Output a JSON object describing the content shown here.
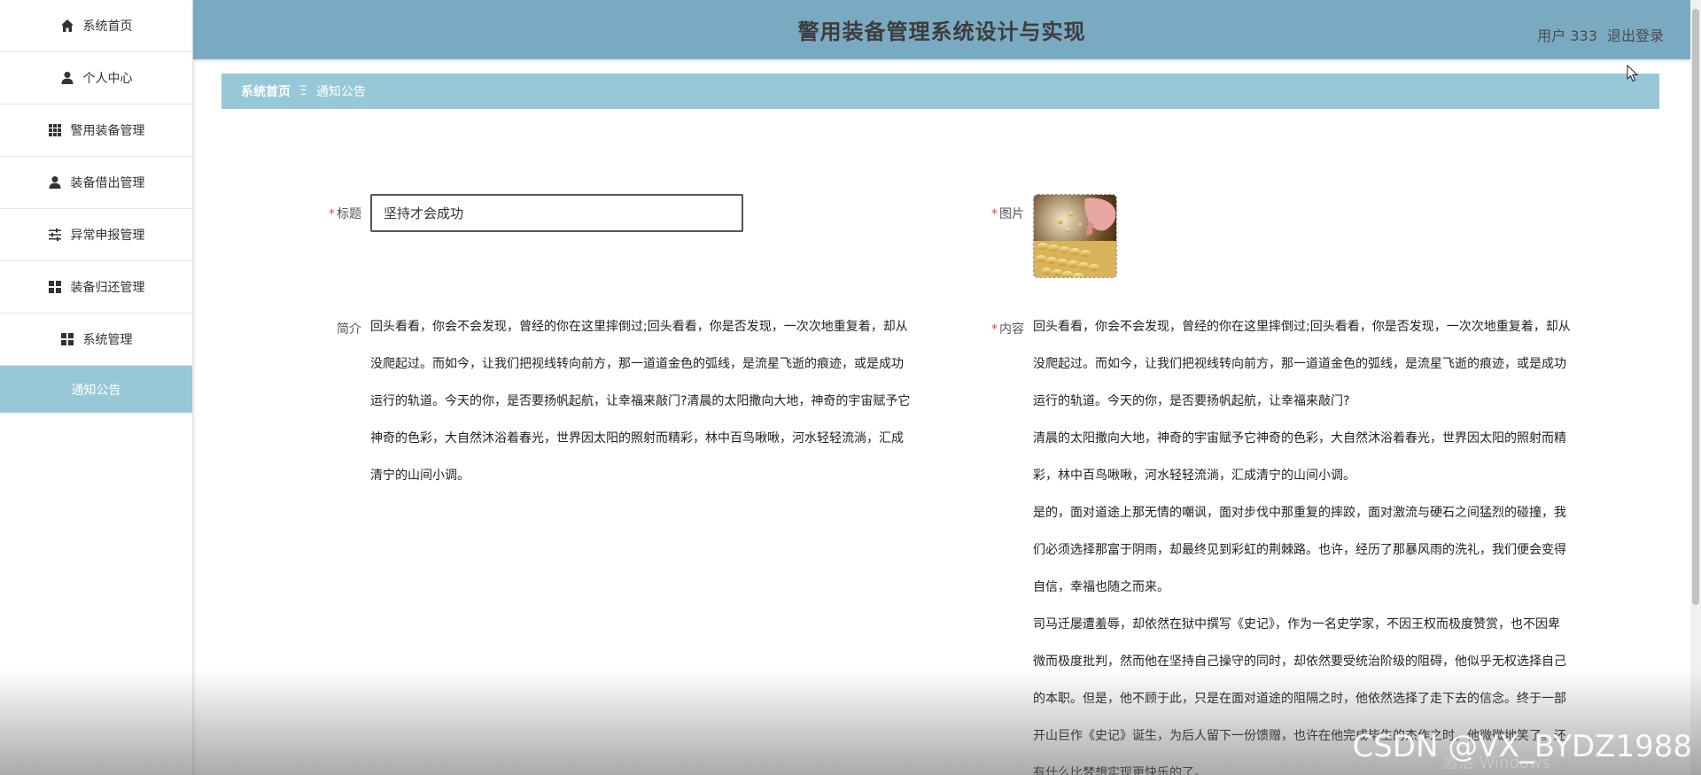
{
  "header": {
    "title": "警用装备管理系统设计与实现",
    "user_label": "用户 333",
    "logout_label": "退出登录"
  },
  "sidebar": {
    "items": [
      {
        "label": "系统首页",
        "icon": "home-icon"
      },
      {
        "label": "个人中心",
        "icon": "user-icon"
      },
      {
        "label": "警用装备管理",
        "icon": "grid-icon"
      },
      {
        "label": "装备借出管理",
        "icon": "user-icon"
      },
      {
        "label": "异常申报管理",
        "icon": "sliders-icon"
      },
      {
        "label": "装备归还管理",
        "icon": "apps-icon"
      },
      {
        "label": "系统管理",
        "icon": "apps-icon"
      }
    ],
    "sub_active": "通知公告"
  },
  "breadcrumb": {
    "home": "系统首页",
    "separator": "Ξ",
    "current": "通知公告"
  },
  "form": {
    "title_label": "标题",
    "title_value": "坚持才会成功",
    "image_label": "图片",
    "summary_label": "简介",
    "summary_lines": [
      "回头看看，你会不会发现，曾经的你在这里摔倒过;回头看看，你是否发现，一次次地重复着，却从",
      "没爬起过。而如今，让我们把视线转向前方，那一道道金色的弧线，是流星飞逝的痕迹，或是成功",
      "运行的轨道。今天的你，是否要扬帆起航，让幸福来敲门?清晨的太阳撒向大地，神奇的宇宙赋予它",
      "神奇的色彩，大自然沐浴着春光，世界因太阳的照射而精彩，林中百鸟啾啾，河水轻轻流淌，汇成",
      "清宁的山间小调。"
    ],
    "content_label": "内容",
    "content_lines": [
      "回头看看，你会不会发现，曾经的你在这里摔倒过;回头看看，你是否发现，一次次地重复着，却从",
      "没爬起过。而如今，让我们把视线转向前方，那一道道金色的弧线，是流星飞逝的痕迹，或是成功",
      "运行的轨道。今天的你，是否要扬帆起航，让幸福来敲门?",
      "清晨的太阳撒向大地，神奇的宇宙赋予它神奇的色彩，大自然沐浴着春光，世界因太阳的照射而精",
      "彩，林中百鸟啾啾，河水轻轻流淌，汇成清宁的山间小调。",
      "是的，面对道途上那无情的嘲讽，面对步伐中那重复的摔跤，面对激流与硬石之间猛烈的碰撞，我",
      "们必须选择那富于阴雨，却最终见到彩虹的荆棘路。也许，经历了那暴风雨的洗礼，我们便会变得",
      "自信，幸福也随之而来。",
      "司马迁屡遭羞辱，却依然在狱中撰写《史记》，作为一名史学家，不因王权而极度赞赏，也不因卑",
      "微而极度批判，然而他在坚持自己操守的同时，却依然要受统治阶级的阻碍，他似乎无权选择自己",
      "的本职。但是，他不顾于此，只是在面对道途的阻隔之时，他依然选择了走下去的信念。终于一部",
      "开山巨作《史记》诞生，为后人留下一份馈赠，也许在他完成毕生的杰作之时，他微微地笑了。还",
      "有什么比梦想实现更快乐的了。"
    ]
  },
  "overlay": {
    "watermark": "CSDN @VX_BYDZ1988",
    "activate": "激活 Windows"
  }
}
